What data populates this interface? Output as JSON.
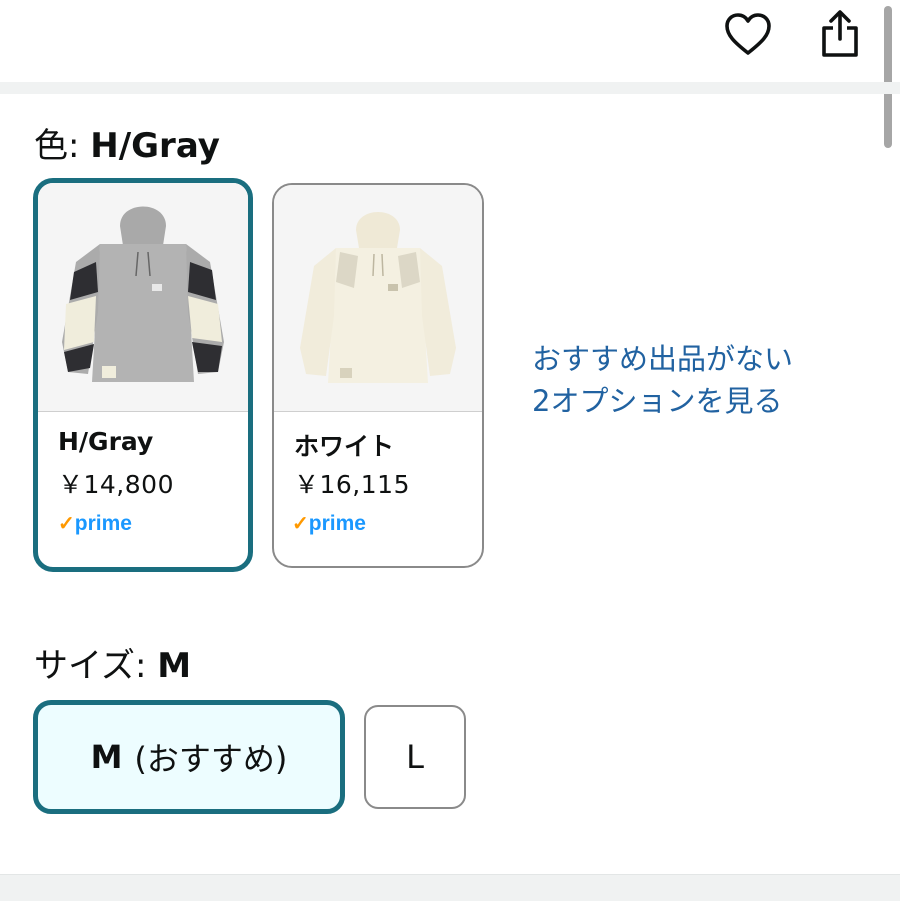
{
  "header": {
    "favorite_icon": "heart-icon",
    "share_icon": "share-icon"
  },
  "color_selector": {
    "label": "色: ",
    "selected_value": "H/Gray",
    "options": [
      {
        "name": "H/Gray",
        "price": "￥14,800",
        "prime": "prime",
        "image": "gray-hoodie-image",
        "selected": true
      },
      {
        "name": "ホワイト",
        "price": "￥16,115",
        "prime": "prime",
        "image": "white-hoodie-image",
        "selected": false
      }
    ],
    "more_options_line1": "おすすめ出品がない",
    "more_options_line2": "2オプションを見る"
  },
  "size_selector": {
    "label": "サイズ: ",
    "selected_value": "M",
    "options": [
      {
        "size": "M",
        "note": "(おすすめ)",
        "selected": true
      },
      {
        "size": "L",
        "note": "",
        "selected": false
      }
    ]
  },
  "colors": {
    "selected_border": "#1a6e7f",
    "selected_fill": "#edfdff",
    "link": "#2162a1",
    "prime_blue": "#1a98ff",
    "prime_check": "#ff9900"
  }
}
